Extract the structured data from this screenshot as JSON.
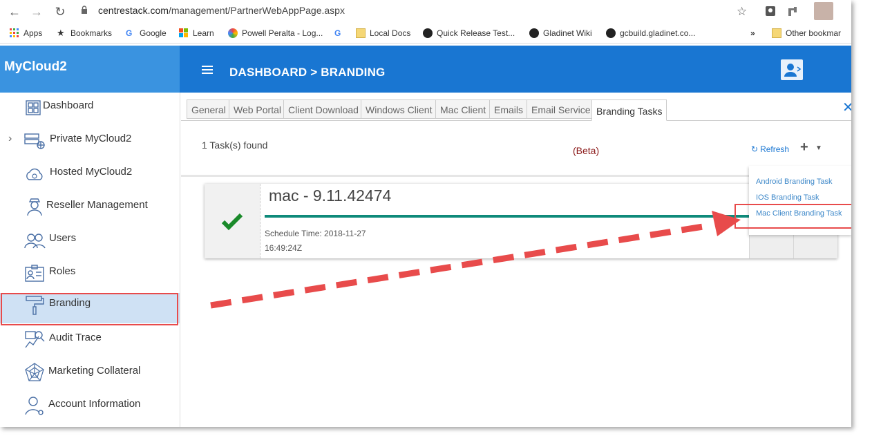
{
  "browser": {
    "url_host": "centrestack.com",
    "url_path": "/management/PartnerWebAppPage.aspx",
    "bookmarks": [
      {
        "label": "Apps",
        "icon": "apps-grid-icon"
      },
      {
        "label": "Bookmarks",
        "icon": "star-icon"
      },
      {
        "label": "Google",
        "icon": "google-icon"
      },
      {
        "label": "Learn",
        "icon": "microsoft-icon"
      },
      {
        "label": "Powell Peralta - Log...",
        "icon": "site-icon"
      },
      {
        "label": "",
        "icon": "google-icon"
      },
      {
        "label": "Local Docs",
        "icon": "folder-icon"
      },
      {
        "label": "Quick Release Test...",
        "icon": "site-icon"
      },
      {
        "label": "Gladinet Wiki",
        "icon": "site-icon"
      },
      {
        "label": "gcbuild.gladinet.co...",
        "icon": "site-icon"
      }
    ],
    "overflow": "»",
    "other_bookmarks": "Other bookmar"
  },
  "app": {
    "brand": "MyCloud2",
    "breadcrumb": "DASHBOARD >  BRANDING"
  },
  "sidebar": {
    "items": [
      {
        "label": "Dashboard",
        "icon": "dashboard-grid-icon"
      },
      {
        "label": "Private MyCloud2",
        "icon": "network-server-icon",
        "expandable": true
      },
      {
        "label": "Hosted MyCloud2",
        "icon": "cloud-icon"
      },
      {
        "label": "Reseller Management",
        "icon": "reseller-person-icon"
      },
      {
        "label": "Users",
        "icon": "users-icon"
      },
      {
        "label": "Roles",
        "icon": "id-card-icon"
      },
      {
        "label": "Branding",
        "icon": "paint-roller-icon",
        "active": true
      },
      {
        "label": "Audit Trace",
        "icon": "audit-chart-icon"
      },
      {
        "label": "Marketing Collateral",
        "icon": "spider-web-icon"
      },
      {
        "label": "Account Information",
        "icon": "account-settings-icon"
      }
    ]
  },
  "tabs": [
    "General",
    "Web Portal",
    "Client Download",
    "Windows Client",
    "Mac Client",
    "Emails",
    "Email Service",
    "Branding Tasks"
  ],
  "active_tab": "Branding Tasks",
  "toolbar": {
    "task_count": "1 Task(s) found",
    "beta": "(Beta)",
    "refresh": "Refresh"
  },
  "task": {
    "title": "mac - 9.11.42474",
    "schedule_line1": "Schedule Time: 2018-11-27",
    "schedule_line2": "16:49:24Z",
    "progress": 1.0
  },
  "dropdown": {
    "items": [
      "Android Branding Task",
      "IOS Branding Task",
      "Mac Client Branding Task"
    ]
  },
  "colors": {
    "header": "#1976d2",
    "sidebar_head": "#3a93e0",
    "highlight": "#e84b4b",
    "progress": "#0e8a7a",
    "check": "#1a8a2a"
  }
}
